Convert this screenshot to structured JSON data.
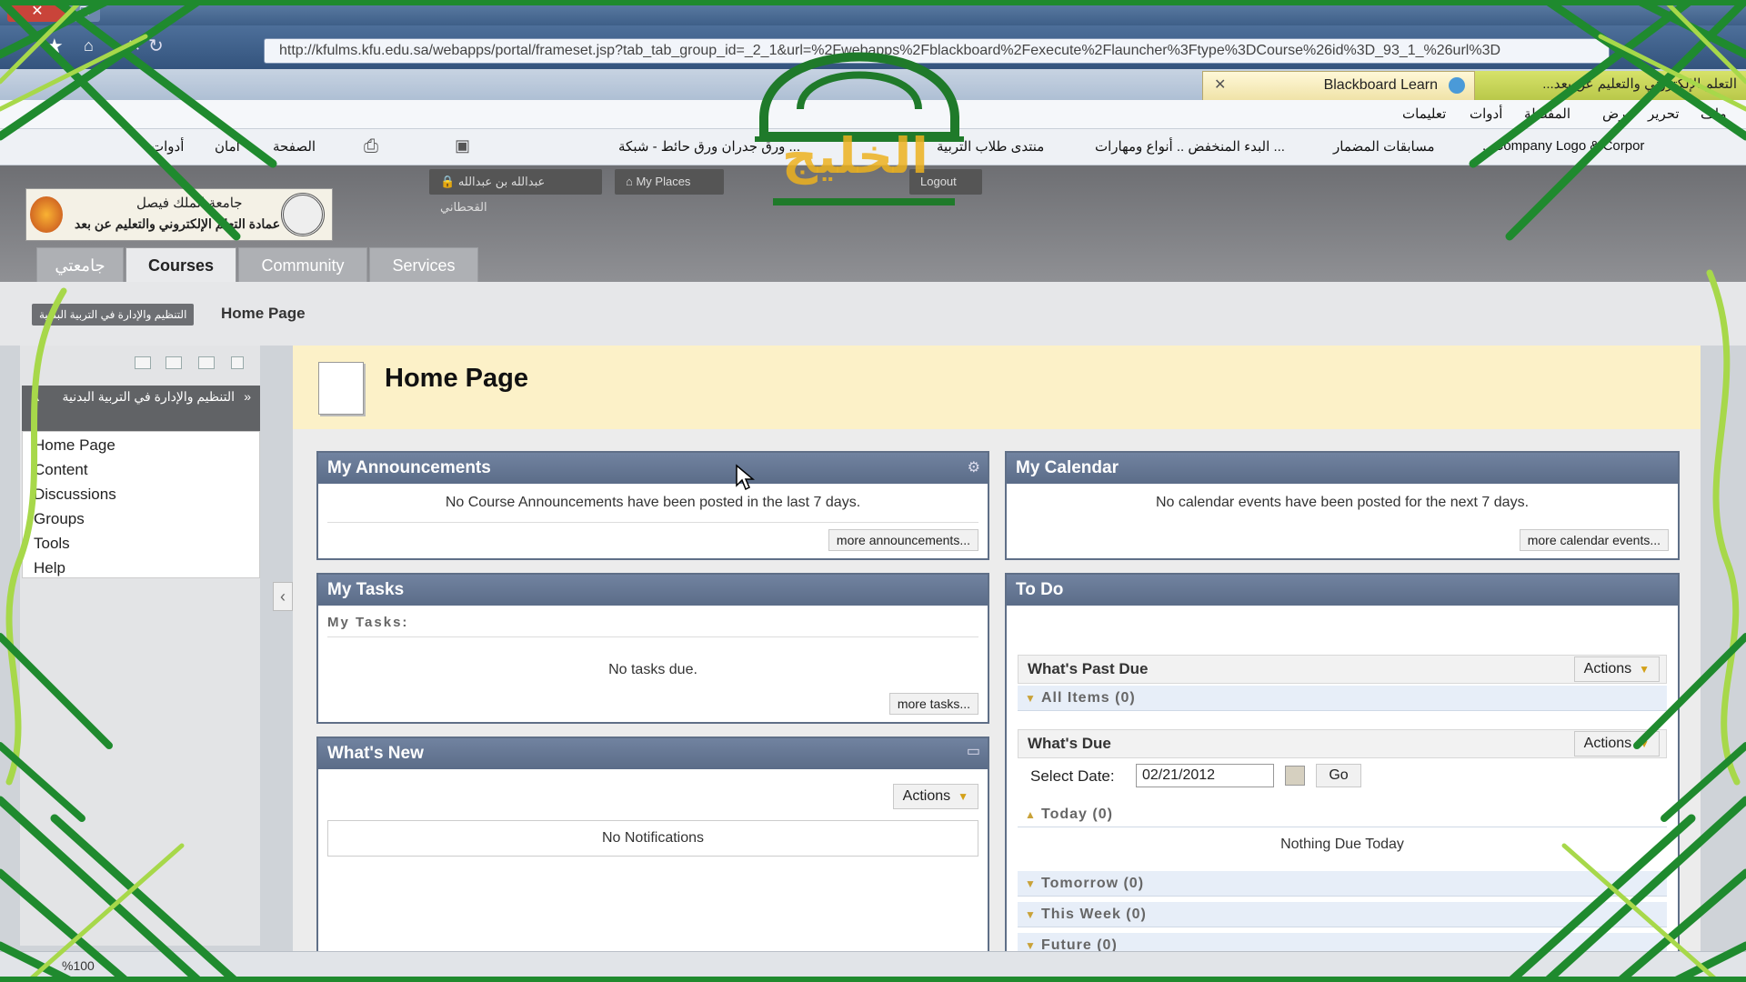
{
  "browser": {
    "url": "http://kfulms.kfu.edu.sa/webapps/portal/frameset.jsp?tab_tab_group_id=_2_1&url=%2Fwebapps%2Fblackboard%2Fexecute%2Flauncher%3Ftype%3DCourse%26id%3D_93_1_%26url%3D",
    "tab_title": "Blackboard Learn",
    "tab_title_2": "...التعلم الإلكتروني والتعليم عن بعد",
    "menu": [
      "ملف",
      "تحرير",
      "عرض",
      "المفضلة",
      "أدوات",
      "تعليمات"
    ],
    "favorites": [
      "...Company Logo & Corpor",
      "مسابقات المضمار",
      "البدء المنخفض .. أنواع ومهارات ...",
      "منتدى طلاب التربية",
      "ورق جدران ورق حائط - شبكة ...",
      "الصفحة",
      "أمان",
      "أدوات"
    ],
    "zoom": "%100"
  },
  "lms": {
    "logo_line1": "جامعة الملك فيصل",
    "logo_line2": "عمادة التعلم الإلكتروني والتعليم عن بعد",
    "user_button": "عبدالله بن عبدالله القحطاني",
    "my_places": "My Places",
    "logout": "Logout",
    "tabs": [
      "جامعتي",
      "Courses",
      "Community",
      "Services"
    ],
    "breadcrumb_course": "التنظيم والإدارة في التربية البدنية",
    "breadcrumb_page": "Home Page",
    "course_title": "التنظيم والإدارة في التربية البدنية",
    "course_menu": [
      "Home Page",
      "Content",
      "Discussions",
      "Groups",
      "Tools",
      "Help"
    ],
    "page_title": "Home Page"
  },
  "modules": {
    "announcements": {
      "title": "My Announcements",
      "text": "No Course Announcements have been posted in the last 7 days.",
      "more": "more announcements..."
    },
    "calendar": {
      "title": "My Calendar",
      "text": "No calendar events have been posted for the next 7 days.",
      "more": "more calendar events..."
    },
    "tasks": {
      "title": "My Tasks",
      "subtitle": "My Tasks:",
      "text": "No tasks due.",
      "more": "more tasks..."
    },
    "whatsnew": {
      "title": "What's New",
      "actions": "Actions",
      "text": "No Notifications"
    },
    "todo": {
      "title": "To Do",
      "past_due": "What's Past Due",
      "actions": "Actions",
      "all_items": "All Items (0)",
      "whats_due": "What's Due",
      "select_date_label": "Select Date:",
      "select_date_value": "02/21/2012",
      "go": "Go",
      "today": "Today (0)",
      "nothing_due": "Nothing Due Today",
      "tomorrow": "Tomorrow (0)",
      "this_week": "This Week (0)",
      "future": "Future (0)"
    }
  },
  "watermark": "الخليج",
  "colors": {
    "frame_green": "#1f8a2e",
    "frame_lime": "#a7d84a",
    "module_header": "#5b6c88",
    "page_header_bg": "#fcf1c8"
  }
}
